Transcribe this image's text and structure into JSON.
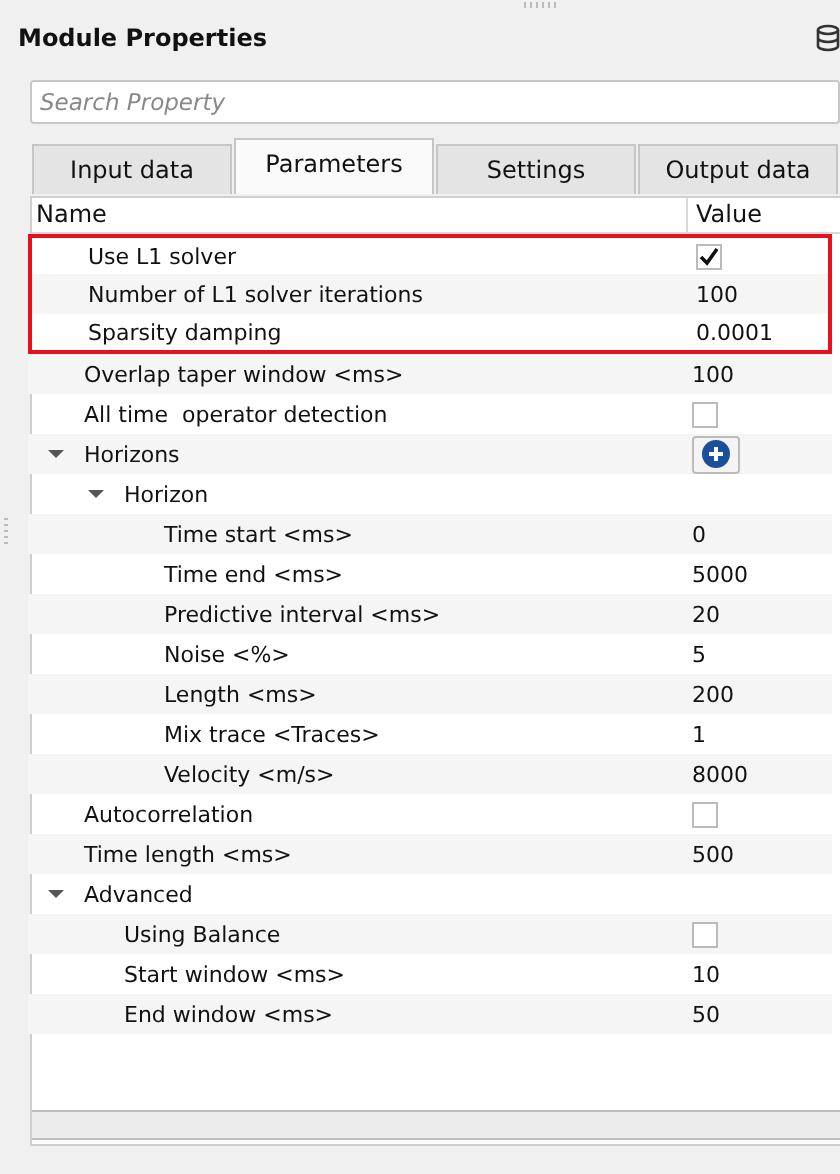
{
  "panel": {
    "title": "Module Properties"
  },
  "search": {
    "placeholder": "Search Property"
  },
  "tabs": [
    {
      "label": "Input data",
      "selected": false
    },
    {
      "label": "Parameters",
      "selected": true
    },
    {
      "label": "Settings",
      "selected": false
    },
    {
      "label": "Output data",
      "selected": false
    }
  ],
  "table": {
    "columns": [
      "Name",
      "Value"
    ],
    "rows": [
      {
        "name": "Use L1 solver",
        "kind": "check",
        "checked": true,
        "highlighted": true
      },
      {
        "name": "Number of L1 solver iterations",
        "kind": "text",
        "value": "100",
        "highlighted": true
      },
      {
        "name": "Sparsity damping",
        "kind": "text",
        "value": "0.0001",
        "highlighted": true
      },
      {
        "name": "Overlap taper window <ms>",
        "kind": "text",
        "value": "100",
        "highlighted": false
      },
      {
        "name": "All time  operator detection",
        "kind": "check",
        "checked": false,
        "highlighted": false
      },
      {
        "name": "Horizons",
        "kind": "add",
        "expanded": true,
        "highlighted": false,
        "children": [
          {
            "name": "Horizon",
            "kind": "group",
            "expanded": true,
            "children": [
              {
                "name": "Time start <ms>",
                "kind": "text",
                "value": "0"
              },
              {
                "name": "Time end <ms>",
                "kind": "text",
                "value": "5000"
              },
              {
                "name": "Predictive interval <ms>",
                "kind": "text",
                "value": "20"
              },
              {
                "name": "Noise <%>",
                "kind": "text",
                "value": "5"
              },
              {
                "name": "Length <ms>",
                "kind": "text",
                "value": "200"
              },
              {
                "name": "Mix trace <Traces>",
                "kind": "text",
                "value": "1"
              },
              {
                "name": "Velocity <m/s>",
                "kind": "text",
                "value": "8000"
              }
            ]
          }
        ]
      },
      {
        "name": "Autocorrelation",
        "kind": "check",
        "checked": false,
        "highlighted": false
      },
      {
        "name": "Time length <ms>",
        "kind": "text",
        "value": "500",
        "highlighted": false
      },
      {
        "name": "Advanced",
        "kind": "group",
        "expanded": true,
        "highlighted": false,
        "children": [
          {
            "name": "Using Balance",
            "kind": "check",
            "checked": false
          },
          {
            "name": "Start window <ms>",
            "kind": "text",
            "value": "10"
          },
          {
            "name": "End window <ms>",
            "kind": "text",
            "value": "50"
          }
        ]
      }
    ]
  }
}
